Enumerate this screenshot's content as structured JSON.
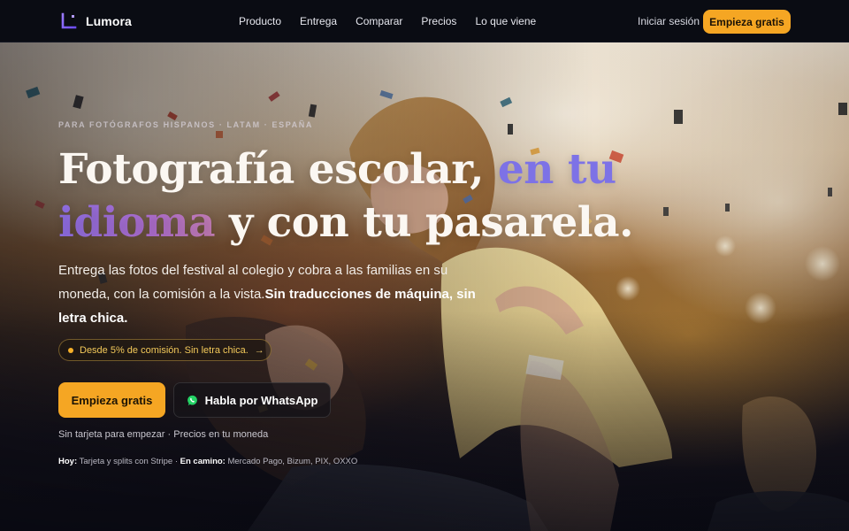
{
  "brand": {
    "name": "Lumora",
    "accent": "#7c5cff",
    "cta_color": "#f5a623"
  },
  "nav": {
    "links": [
      "Producto",
      "Entrega",
      "Comparar",
      "Precios",
      "Lo que viene"
    ],
    "signin": "Iniciar sesión",
    "cta": "Empieza gratis"
  },
  "hero": {
    "eyebrow": "PARA FOTÓGRAFOS HISPANOS · LATAM · ESPAÑA",
    "headline": {
      "part1": "Fotografía escolar, ",
      "accent1": "en tu",
      "accent2": "idioma",
      "part2": " y con tu pasarela."
    },
    "lede": "Entrega las fotos del festival al colegio y cobra a las familias en su moneda, con la comisión a la vista.",
    "lede_bold": "Sin traducciones de máquina, sin letra chica.",
    "pill": {
      "text": "Desde 5% de comisión. Sin letra chica.",
      "arrow": "→"
    },
    "primary_cta": "Empieza gratis",
    "whatsapp_cta": "Habla por WhatsApp",
    "fineprint": "Sin tarjeta para empezar · Precios en tu moneda",
    "payments": {
      "today_label": "Hoy:",
      "today_text": " Tarjeta y splits con Stripe · ",
      "coming_label": "En camino:",
      "coming_text": " Mercado Pago, Bizum, PIX, OXXO"
    }
  }
}
